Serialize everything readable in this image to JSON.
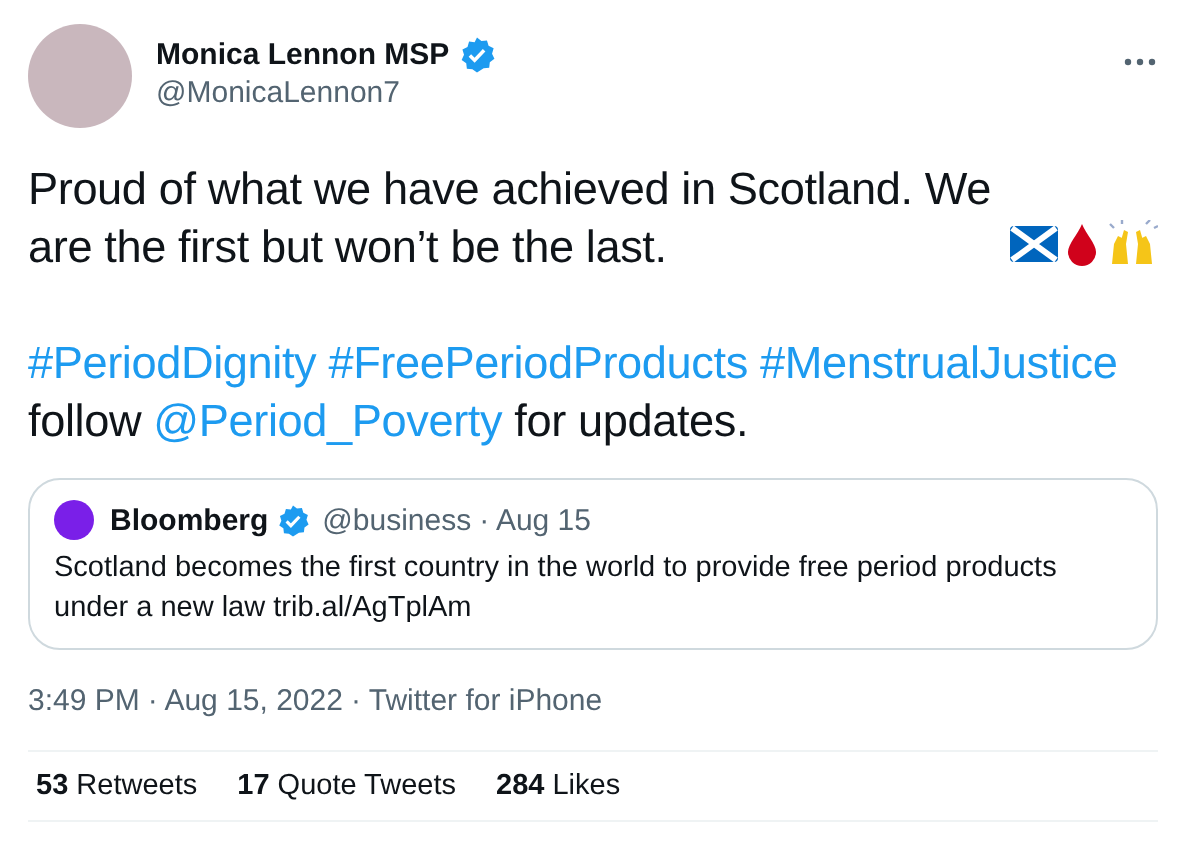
{
  "author": {
    "name": "Monica Lennon MSP",
    "verified": true,
    "handle": "@MonicaLennon7"
  },
  "body": {
    "text": "Proud of what we have achieved in Scotland. We are the first but won’t be the last.",
    "emoji": [
      {
        "kind": "flag"
      },
      {
        "kind": "drop"
      },
      {
        "kind": "raised-hands"
      }
    ]
  },
  "tags_line": [
    {
      "kind": "link",
      "text": "#PeriodDignity"
    },
    {
      "kind": "link",
      "text": "#FreePeriodProducts"
    },
    {
      "kind": "link",
      "text": "#MenstrualJustice"
    },
    {
      "kind": "text",
      "text": "follow"
    },
    {
      "kind": "link",
      "text": "@Period_Poverty"
    },
    {
      "kind": "text",
      "text": "for updates."
    }
  ],
  "quote": {
    "name": "Bloomberg",
    "verified": true,
    "handle": "@business",
    "date": "· Aug 15",
    "text": "Scotland becomes the first country in the world to provide free period products under a new law",
    "link": "trib.al/AgTplAm"
  },
  "timestamp": {
    "time": "3:49 PM",
    "date": "· Aug 15, 2022",
    "source": "· Twitter for iPhone"
  },
  "stats": [
    {
      "count": "53",
      "label": "Retweets"
    },
    {
      "count": "17",
      "label": "Quote Tweets"
    },
    {
      "count": "284",
      "label": "Likes"
    }
  ]
}
